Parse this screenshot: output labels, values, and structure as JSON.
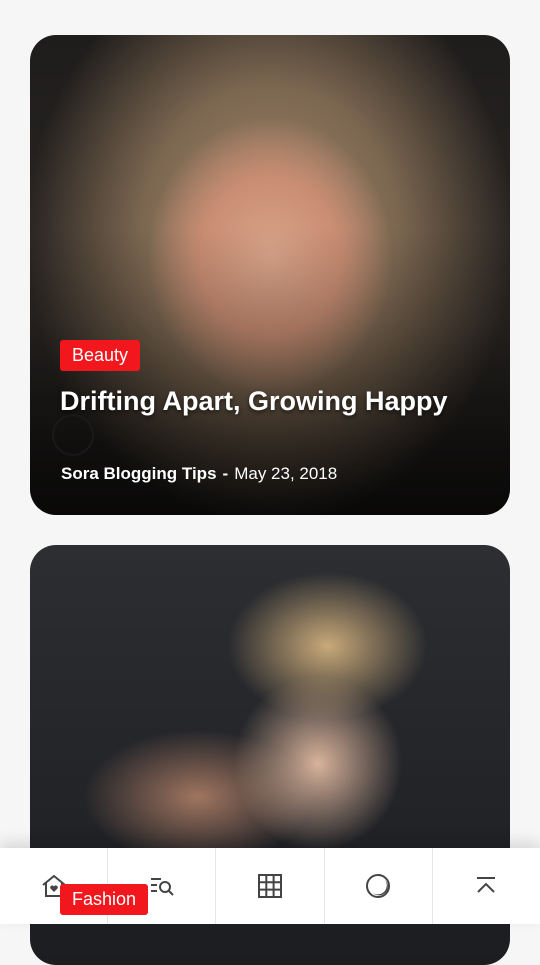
{
  "posts": [
    {
      "category": "Beauty",
      "title": "Drifting Apart, Growing Happy",
      "author": "Sora Blogging Tips",
      "separator": "-",
      "date": "May 23, 2018"
    },
    {
      "category": "Fashion"
    }
  ],
  "bottom_nav": {
    "items": [
      {
        "icon": "home-heart-icon"
      },
      {
        "icon": "search-list-icon"
      },
      {
        "icon": "grid-icon"
      },
      {
        "icon": "dark-mode-icon"
      },
      {
        "icon": "scroll-top-icon"
      }
    ]
  },
  "colors": {
    "accent": "#f2161d",
    "background": "#f6f6f6"
  }
}
